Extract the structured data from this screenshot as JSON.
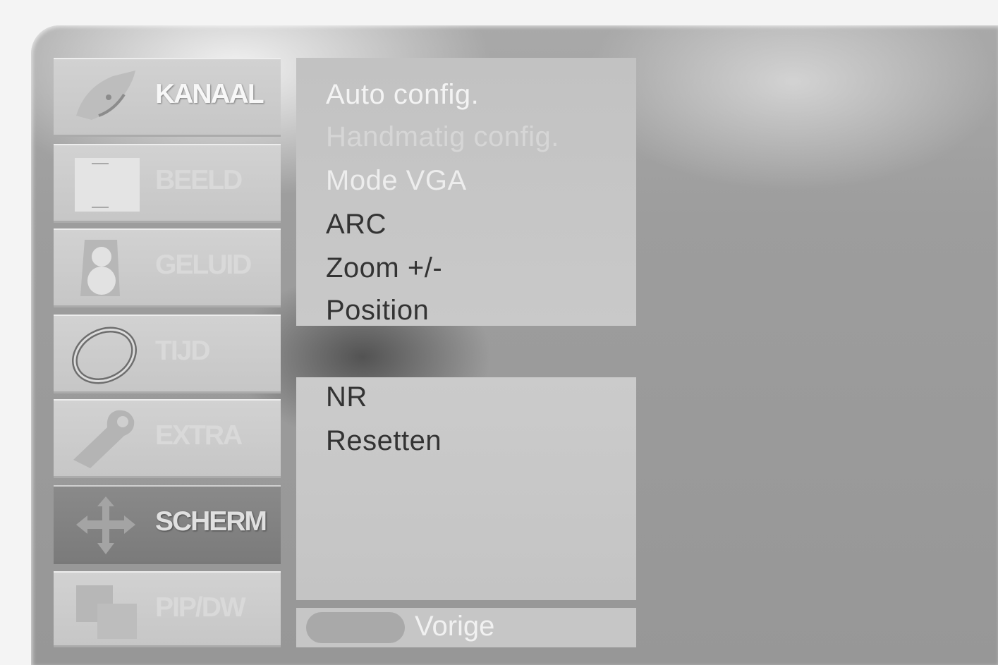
{
  "menu": {
    "categories": [
      {
        "label": "KANAAL",
        "icon": "satellite-dish-icon",
        "state": "highlighted"
      },
      {
        "label": "BEELD",
        "icon": "picture-icon",
        "state": "normal"
      },
      {
        "label": "GELUID",
        "icon": "speaker-icon",
        "state": "normal"
      },
      {
        "label": "TIJD",
        "icon": "clock-ring-icon",
        "state": "normal"
      },
      {
        "label": "EXTRA",
        "icon": "wrench-icon",
        "state": "normal"
      },
      {
        "label": "SCHERM",
        "icon": "move-arrows-icon",
        "state": "selected"
      },
      {
        "label": "PIP/DW",
        "icon": "pip-windows-icon",
        "state": "normal"
      }
    ],
    "submenu_top": [
      {
        "label": "Auto config.",
        "state": "available"
      },
      {
        "label": "Handmatig config.",
        "state": "disabled"
      },
      {
        "label": "Mode VGA",
        "state": "available"
      },
      {
        "label": "ARC",
        "state": "active"
      },
      {
        "label": "Zoom +/-",
        "state": "active"
      },
      {
        "label": "Position",
        "state": "active"
      }
    ],
    "submenu_bottom": [
      {
        "label": "NR",
        "state": "active"
      },
      {
        "label": "Resetten",
        "state": "active"
      }
    ],
    "footer": {
      "back_label": "Vorige"
    }
  },
  "colors": {
    "panel": "#9c9c9c",
    "category_bg": "#c9c9c9",
    "category_selected_bg": "#7f7f7f",
    "submenu_bg": "#c7c7c7",
    "text_dark": "#333333",
    "text_light": "#f3f3f3"
  }
}
